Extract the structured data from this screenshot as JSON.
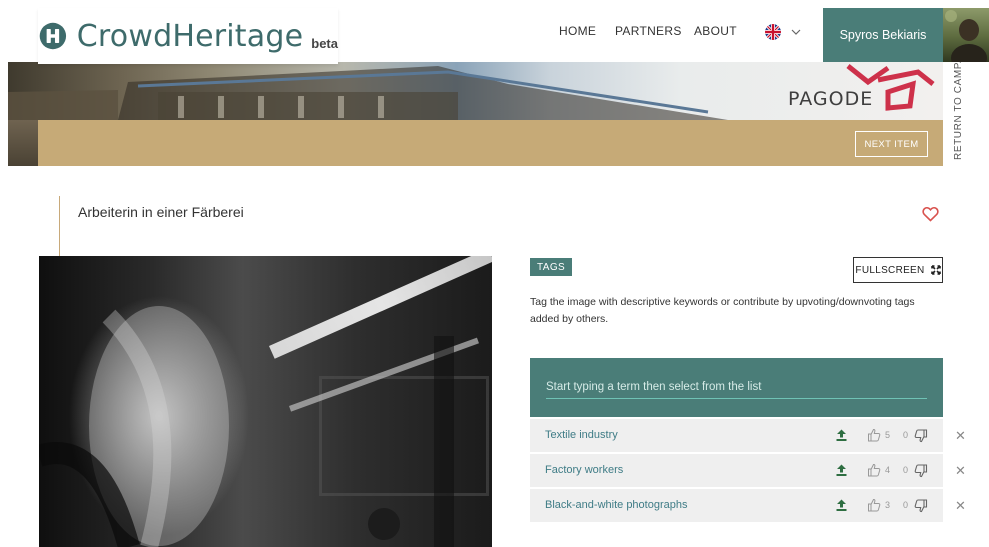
{
  "header": {
    "brand": "CrowdHeritage",
    "brand_badge": "beta",
    "nav": [
      "HOME",
      "PARTNERS",
      "ABOUT"
    ],
    "user_name": "Spyros Bekiaris"
  },
  "banner": {
    "campaign_logo_text": "PAGODE",
    "next_item_label": "NEXT ITEM",
    "return_label": "RETURN TO CAMPAIGN"
  },
  "item": {
    "title": "Arbeiterin in einer Färberei"
  },
  "tags_panel": {
    "badge": "TAGS",
    "fullscreen_label": "FULLSCREEN",
    "description": "Tag the image with descriptive keywords or contribute by upvoting/downvoting tags added by others.",
    "search_placeholder": "Start typing a term then select from the list",
    "tags": [
      {
        "label": "Textile industry",
        "upvotes": "5",
        "downvotes": "0"
      },
      {
        "label": "Factory workers",
        "upvotes": "4",
        "downvotes": "0"
      },
      {
        "label": "Black-and-white photographs",
        "upvotes": "3",
        "downvotes": "0"
      }
    ]
  },
  "colors": {
    "brand_teal": "#4a7d78",
    "banner_tan": "#c6aa77",
    "tag_link": "#3f7c86",
    "heart_red": "#d9534f",
    "upload_green": "#2e6e41"
  },
  "icons": [
    "logo-mark-icon",
    "uk-flag-icon",
    "chevron-down-icon",
    "heart-icon",
    "expand-icon",
    "upload-arrow-icon",
    "thumb-up-icon",
    "thumb-down-icon",
    "close-icon"
  ]
}
